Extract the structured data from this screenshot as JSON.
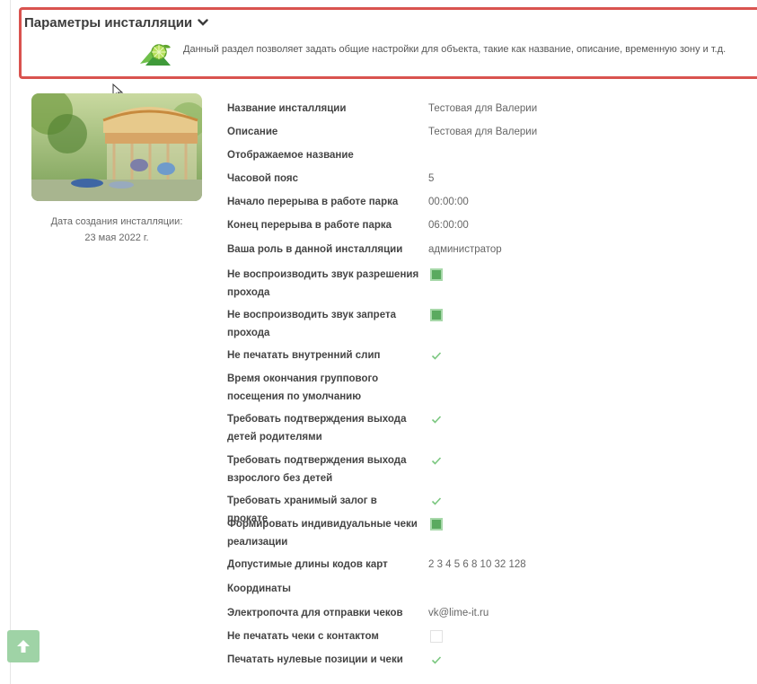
{
  "section": {
    "title": "Параметры инсталляции",
    "description": "Данный раздел позволяет задать общие настройки для объекта, такие как название, описание, временную зону и т.д.",
    "icon": "lime-slice-icon",
    "toggle_icon": "chevron-down-icon"
  },
  "profile": {
    "photo_subject": "carousel-photo",
    "created_label": "Дата создания инсталляции:",
    "created_date": "23 мая 2022 г."
  },
  "settings": [
    {
      "label": "Название инсталляции",
      "value": "Тестовая для Валерии"
    },
    {
      "label": "Описание",
      "value": "Тестовая для Валерии"
    },
    {
      "label": "Отображаемое название",
      "value": ""
    },
    {
      "label": "Часовой пояс",
      "value": "5"
    },
    {
      "label": "Начало перерыва в работе парка",
      "value": "00:00:00"
    },
    {
      "label": "Конец перерыва в работе парка",
      "value": "06:00:00"
    },
    {
      "label": "Ваша роль в данной инсталляции",
      "value": "администратор"
    },
    {
      "label": "Не воспроизводить звук разрешения прохода",
      "checkbox": "square"
    },
    {
      "label": "Не воспроизводить звук запрета прохода",
      "checkbox": "square"
    },
    {
      "label": "Не печатать внутренний слип",
      "checkbox": "check"
    },
    {
      "label": "Время окончания группового посещения по умолчанию",
      "value": ""
    },
    {
      "label": "Требовать подтверждения выхода детей родителями",
      "checkbox": "check"
    },
    {
      "label": "Требовать подтверждения выхода взрослого без детей",
      "checkbox": "check"
    },
    {
      "label": "Требовать хранимый залог в прокате",
      "checkbox": "check"
    },
    {
      "label": "Формировать индивидуальные чеки реализации",
      "checkbox": "square"
    },
    {
      "label": "Допустимые длины кодов карт",
      "value": "2 3 4 5 6 8 10 32 128"
    },
    {
      "label": "Координаты",
      "value": ""
    },
    {
      "label": "Электропочта для отправки чеков",
      "value": "vk@lime-it.ru"
    },
    {
      "label": "Не печатать чеки с контактом",
      "checkbox": "empty"
    },
    {
      "label": "Печатать нулевые позиции и чеки",
      "checkbox": "check"
    }
  ],
  "colors": {
    "header_border": "#d9534f",
    "checkbox_green": "#5aaa5f",
    "scroll_button": "#9fd3a6"
  },
  "scroll_top": {
    "icon": "arrow-up-icon"
  }
}
